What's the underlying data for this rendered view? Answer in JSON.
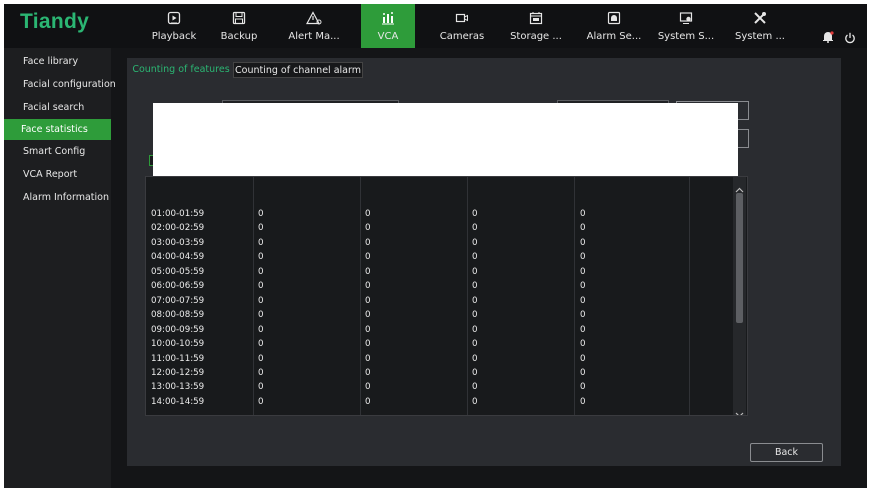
{
  "brand": {
    "logo": "Tiandy",
    "accent": "#2e9c3a"
  },
  "topnav": [
    {
      "label": "Playback",
      "icon": "playback-icon",
      "active": false
    },
    {
      "label": "Backup",
      "icon": "backup-icon",
      "active": false
    },
    {
      "label": "Alert Ma...",
      "icon": "alert-icon",
      "active": false
    },
    {
      "label": "VCA",
      "icon": "vca-icon",
      "active": true
    },
    {
      "label": "Cameras",
      "icon": "camera-icon",
      "active": false
    },
    {
      "label": "Storage ...",
      "icon": "storage-icon",
      "active": false
    },
    {
      "label": "Alarm Se...",
      "icon": "alarm-settings-icon",
      "active": false
    },
    {
      "label": "System S...",
      "icon": "system-settings-icon",
      "active": false
    },
    {
      "label": "System ...",
      "icon": "system-tools-icon",
      "active": false
    }
  ],
  "sidebar": {
    "items": [
      {
        "label": "Face library",
        "active": false
      },
      {
        "label": "Facial configuration",
        "active": false
      },
      {
        "label": "Facial search",
        "active": false
      },
      {
        "label": "Face statistics",
        "active": true
      },
      {
        "label": "Smart Config",
        "active": false
      },
      {
        "label": "VCA Report",
        "active": false
      },
      {
        "label": "Alarm Information",
        "active": false
      }
    ]
  },
  "tabs": [
    {
      "label": "Counting of features",
      "active": true
    },
    {
      "label": "Counting of channel alarm",
      "active": false
    }
  ],
  "table": {
    "rows": [
      [
        "01:00-01:59",
        "0",
        "0",
        "0",
        "0"
      ],
      [
        "02:00-02:59",
        "0",
        "0",
        "0",
        "0"
      ],
      [
        "03:00-03:59",
        "0",
        "0",
        "0",
        "0"
      ],
      [
        "04:00-04:59",
        "0",
        "0",
        "0",
        "0"
      ],
      [
        "05:00-05:59",
        "0",
        "0",
        "0",
        "0"
      ],
      [
        "06:00-06:59",
        "0",
        "0",
        "0",
        "0"
      ],
      [
        "07:00-07:59",
        "0",
        "0",
        "0",
        "0"
      ],
      [
        "08:00-08:59",
        "0",
        "0",
        "0",
        "0"
      ],
      [
        "09:00-09:59",
        "0",
        "0",
        "0",
        "0"
      ],
      [
        "10:00-10:59",
        "0",
        "0",
        "0",
        "0"
      ],
      [
        "11:00-11:59",
        "0",
        "0",
        "0",
        "0"
      ],
      [
        "12:00-12:59",
        "0",
        "0",
        "0",
        "0"
      ],
      [
        "13:00-13:59",
        "0",
        "0",
        "0",
        "0"
      ],
      [
        "14:00-14:59",
        "0",
        "0",
        "0",
        "0"
      ]
    ]
  },
  "footer": {
    "back_label": "Back"
  }
}
